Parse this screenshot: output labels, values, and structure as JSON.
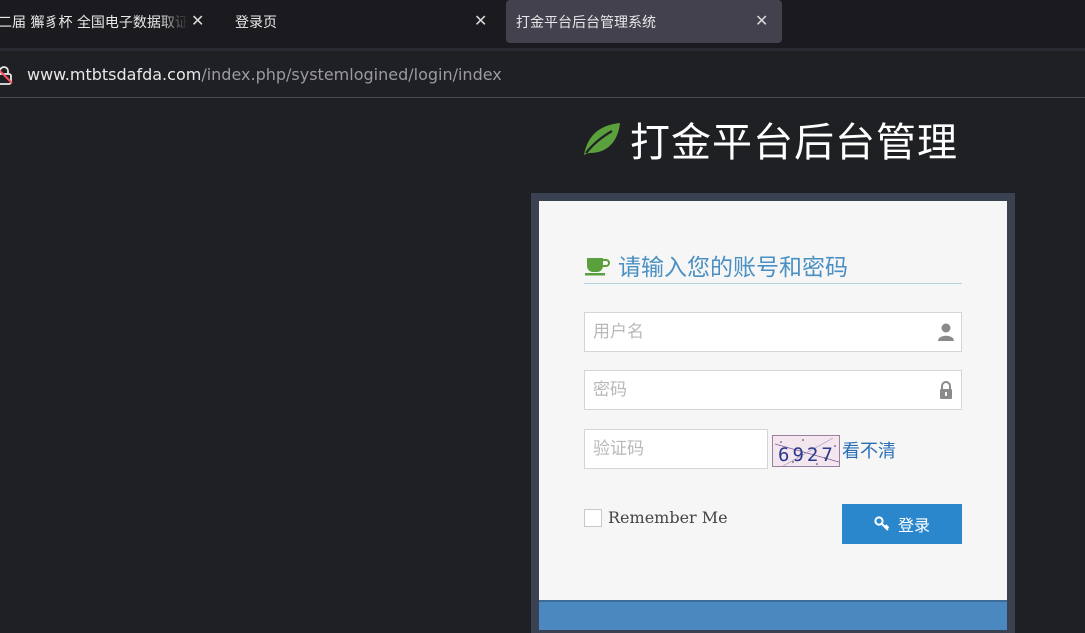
{
  "browser": {
    "tabs": [
      {
        "title": "二届 獬豸杯 全国电子数据取证",
        "active": false
      },
      {
        "title": "登录页",
        "active": false
      },
      {
        "title": "打金平台后台管理系统",
        "active": true
      }
    ],
    "close_glyph": "✕",
    "url_host": "www.mtbtsdafda.com",
    "url_path": "/index.php/systemlogined/login/index",
    "lock_icon": "insecure-lock-icon"
  },
  "page": {
    "brand_icon": "leaf-icon",
    "brand_title": "打金平台后台管理",
    "header_icon": "coffee-cup-icon",
    "login_header": "请输入您的账号和密码",
    "username": {
      "value": "",
      "placeholder": "用户名",
      "icon": "user-icon"
    },
    "password": {
      "value": "",
      "placeholder": "密码",
      "icon": "lock-icon"
    },
    "captcha": {
      "value": "",
      "placeholder": "验证码",
      "image_text": "6927",
      "refresh_link": "看不清"
    },
    "remember_label": "Remember Me",
    "remember_checked": false,
    "login_button": "登录",
    "login_button_icon": "key-icon"
  },
  "colors": {
    "brand_leaf": "#5aa03c",
    "header_text": "#4a90c2",
    "login_button": "#2b87cb",
    "card_bottom": "#4c88c0"
  }
}
